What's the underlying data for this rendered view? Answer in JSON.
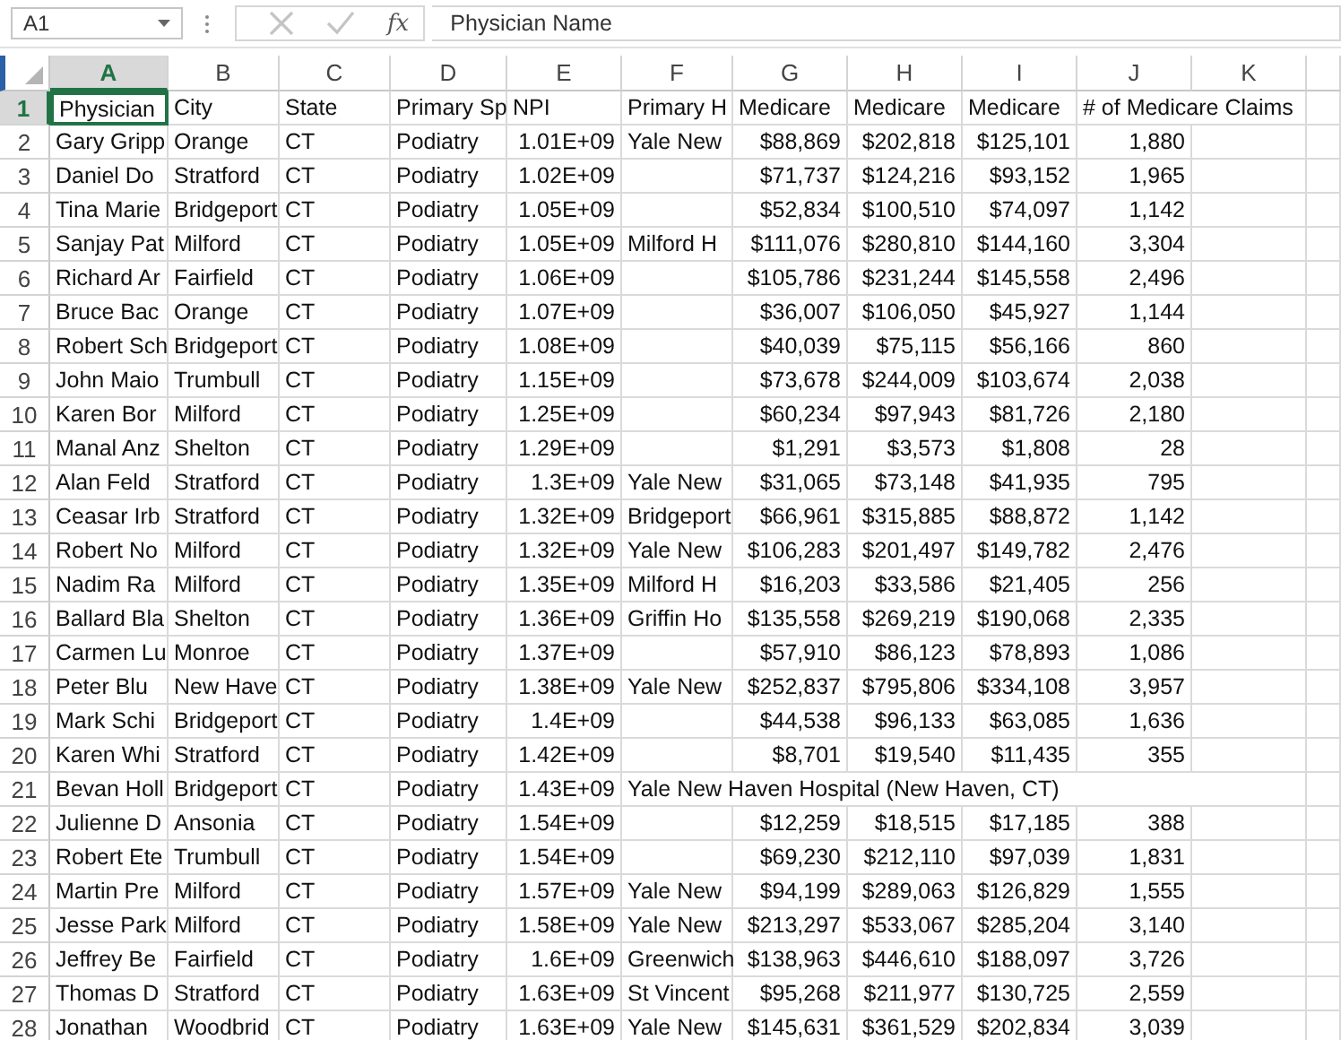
{
  "formula_bar": {
    "name_box": "A1",
    "fx_label": "fx",
    "cancel_disabled": true,
    "enter_disabled": true,
    "value": "Physician Name"
  },
  "column_headers": [
    {
      "label": "A",
      "selected": true
    },
    {
      "label": "B",
      "selected": false
    },
    {
      "label": "C",
      "selected": false
    },
    {
      "label": "D",
      "selected": false
    },
    {
      "label": "E",
      "selected": false
    },
    {
      "label": "F",
      "selected": false
    },
    {
      "label": "G",
      "selected": false
    },
    {
      "label": "H",
      "selected": false
    },
    {
      "label": "I",
      "selected": false
    },
    {
      "label": "J",
      "selected": false
    },
    {
      "label": "K",
      "selected": false
    }
  ],
  "rows": [
    {
      "row": "1",
      "selected": true,
      "physician": "Physician",
      "city": "City",
      "state": "State",
      "specialty": "Primary Sp",
      "npi": "NPI",
      "hospital": "Primary H",
      "medicare_1": "Medicare",
      "medicare_2": "Medicare",
      "medicare_3": "Medicare",
      "claims": "# of Medicare Claims"
    },
    {
      "row": "2",
      "selected": false,
      "physician": "Gary Gripp",
      "city": "Orange",
      "state": "CT",
      "specialty": "Podiatry",
      "npi": "1.01E+09",
      "hospital": "Yale New",
      "medicare_1": "$88,869",
      "medicare_2": "$202,818",
      "medicare_3": "$125,101",
      "claims": "1,880"
    },
    {
      "row": "3",
      "selected": false,
      "physician": "Daniel Do",
      "city": "Stratford",
      "state": "CT",
      "specialty": "Podiatry",
      "npi": "1.02E+09",
      "medicare_1": "$71,737",
      "medicare_2": "$124,216",
      "medicare_3": "$93,152",
      "claims": "1,965"
    },
    {
      "row": "4",
      "selected": false,
      "physician": "Tina Marie",
      "city": "Bridgeport",
      "state": "CT",
      "specialty": "Podiatry",
      "npi": "1.05E+09",
      "medicare_1": "$52,834",
      "medicare_2": "$100,510",
      "medicare_3": "$74,097",
      "claims": "1,142"
    },
    {
      "row": "5",
      "selected": false,
      "physician": "Sanjay Pat",
      "city": "Milford",
      "state": "CT",
      "specialty": "Podiatry",
      "npi": "1.05E+09",
      "hospital": "Milford H",
      "medicare_1": "$111,076",
      "medicare_2": "$280,810",
      "medicare_3": "$144,160",
      "claims": "3,304"
    },
    {
      "row": "6",
      "selected": false,
      "physician": "Richard Ar",
      "city": "Fairfield",
      "state": "CT",
      "specialty": "Podiatry",
      "npi": "1.06E+09",
      "medicare_1": "$105,786",
      "medicare_2": "$231,244",
      "medicare_3": "$145,558",
      "claims": "2,496"
    },
    {
      "row": "7",
      "selected": false,
      "physician": "Bruce Bac",
      "city": "Orange",
      "state": "CT",
      "specialty": "Podiatry",
      "npi": "1.07E+09",
      "medicare_1": "$36,007",
      "medicare_2": "$106,050",
      "medicare_3": "$45,927",
      "claims": "1,144"
    },
    {
      "row": "8",
      "selected": false,
      "physician": "Robert Sch",
      "city": "Bridgeport",
      "state": "CT",
      "specialty": "Podiatry",
      "npi": "1.08E+09",
      "medicare_1": "$40,039",
      "medicare_2": "$75,115",
      "medicare_3": "$56,166",
      "claims": "860"
    },
    {
      "row": "9",
      "selected": false,
      "physician": "John Maio",
      "city": "Trumbull",
      "state": "CT",
      "specialty": "Podiatry",
      "npi": "1.15E+09",
      "medicare_1": "$73,678",
      "medicare_2": "$244,009",
      "medicare_3": "$103,674",
      "claims": "2,038"
    },
    {
      "row": "10",
      "selected": false,
      "physician": "Karen Bor",
      "city": "Milford",
      "state": "CT",
      "specialty": "Podiatry",
      "npi": "1.25E+09",
      "medicare_1": "$60,234",
      "medicare_2": "$97,943",
      "medicare_3": "$81,726",
      "claims": "2,180"
    },
    {
      "row": "11",
      "selected": false,
      "physician": "Manal Anz",
      "city": "Shelton",
      "state": "CT",
      "specialty": "Podiatry",
      "npi": "1.29E+09",
      "medicare_1": "$1,291",
      "medicare_2": "$3,573",
      "medicare_3": "$1,808",
      "claims": "28"
    },
    {
      "row": "12",
      "selected": false,
      "physician": "Alan Feld",
      "city": "Stratford",
      "state": "CT",
      "specialty": "Podiatry",
      "npi": "1.3E+09",
      "hospital": "Yale New",
      "medicare_1": "$31,065",
      "medicare_2": "$73,148",
      "medicare_3": "$41,935",
      "claims": "795"
    },
    {
      "row": "13",
      "selected": false,
      "physician": "Ceasar Irb",
      "city": "Stratford",
      "state": "CT",
      "specialty": "Podiatry",
      "npi": "1.32E+09",
      "hospital": "Bridgeport",
      "medicare_1": "$66,961",
      "medicare_2": "$315,885",
      "medicare_3": "$88,872",
      "claims": "1,142"
    },
    {
      "row": "14",
      "selected": false,
      "physician": "Robert No",
      "city": "Milford",
      "state": "CT",
      "specialty": "Podiatry",
      "npi": "1.32E+09",
      "hospital": "Yale New",
      "medicare_1": "$106,283",
      "medicare_2": "$201,497",
      "medicare_3": "$149,782",
      "claims": "2,476"
    },
    {
      "row": "15",
      "selected": false,
      "physician": "Nadim Ra",
      "city": "Milford",
      "state": "CT",
      "specialty": "Podiatry",
      "npi": "1.35E+09",
      "hospital": "Milford H",
      "medicare_1": "$16,203",
      "medicare_2": "$33,586",
      "medicare_3": "$21,405",
      "claims": "256"
    },
    {
      "row": "16",
      "selected": false,
      "physician": "Ballard Bla",
      "city": "Shelton",
      "state": "CT",
      "specialty": "Podiatry",
      "npi": "1.36E+09",
      "hospital": "Griffin Ho",
      "medicare_1": "$135,558",
      "medicare_2": "$269,219",
      "medicare_3": "$190,068",
      "claims": "2,335"
    },
    {
      "row": "17",
      "selected": false,
      "physician": "Carmen Lu",
      "city": "Monroe",
      "state": "CT",
      "specialty": "Podiatry",
      "npi": "1.37E+09",
      "medicare_1": "$57,910",
      "medicare_2": "$86,123",
      "medicare_3": "$78,893",
      "claims": "1,086"
    },
    {
      "row": "18",
      "selected": false,
      "physician": "Peter Blu",
      "city": "New Have",
      "state": "CT",
      "specialty": "Podiatry",
      "npi": "1.38E+09",
      "hospital": "Yale New",
      "medicare_1": "$252,837",
      "medicare_2": "$795,806",
      "medicare_3": "$334,108",
      "claims": "3,957"
    },
    {
      "row": "19",
      "selected": false,
      "physician": "Mark Schi",
      "city": "Bridgeport",
      "state": "CT",
      "specialty": "Podiatry",
      "npi": "1.4E+09",
      "medicare_1": "$44,538",
      "medicare_2": "$96,133",
      "medicare_3": "$63,085",
      "claims": "1,636"
    },
    {
      "row": "20",
      "selected": false,
      "physician": "Karen Whi",
      "city": "Stratford",
      "state": "CT",
      "specialty": "Podiatry",
      "npi": "1.42E+09",
      "medicare_1": "$8,701",
      "medicare_2": "$19,540",
      "medicare_3": "$11,435",
      "claims": "355"
    },
    {
      "row": "21",
      "selected": false,
      "physician": "Bevan Holl",
      "city": "Bridgeport",
      "state": "CT",
      "specialty": "Podiatry",
      "npi": "1.43E+09",
      "hospital": "Yale New Haven Hospital (New Haven, CT)"
    },
    {
      "row": "22",
      "selected": false,
      "physician": "Julienne D",
      "city": "Ansonia",
      "state": "CT",
      "specialty": "Podiatry",
      "npi": "1.54E+09",
      "medicare_1": "$12,259",
      "medicare_2": "$18,515",
      "medicare_3": "$17,185",
      "claims": "388"
    },
    {
      "row": "23",
      "selected": false,
      "physician": "Robert Ete",
      "city": "Trumbull",
      "state": "CT",
      "specialty": "Podiatry",
      "npi": "1.54E+09",
      "medicare_1": "$69,230",
      "medicare_2": "$212,110",
      "medicare_3": "$97,039",
      "claims": "1,831"
    },
    {
      "row": "24",
      "selected": false,
      "physician": "Martin Pre",
      "city": "Milford",
      "state": "CT",
      "specialty": "Podiatry",
      "npi": "1.57E+09",
      "hospital": "Yale New",
      "medicare_1": "$94,199",
      "medicare_2": "$289,063",
      "medicare_3": "$126,829",
      "claims": "1,555"
    },
    {
      "row": "25",
      "selected": false,
      "physician": "Jesse Park",
      "city": "Milford",
      "state": "CT",
      "specialty": "Podiatry",
      "npi": "1.58E+09",
      "hospital": "Yale New",
      "medicare_1": "$213,297",
      "medicare_2": "$533,067",
      "medicare_3": "$285,204",
      "claims": "3,140"
    },
    {
      "row": "26",
      "selected": false,
      "physician": "Jeffrey Be",
      "city": "Fairfield",
      "state": "CT",
      "specialty": "Podiatry",
      "npi": "1.6E+09",
      "hospital": "Greenwich",
      "medicare_1": "$138,963",
      "medicare_2": "$446,610",
      "medicare_3": "$188,097",
      "claims": "3,726"
    },
    {
      "row": "27",
      "selected": false,
      "physician": "Thomas D",
      "city": "Stratford",
      "state": "CT",
      "specialty": "Podiatry",
      "npi": "1.63E+09",
      "hospital": "St Vincent",
      "medicare_1": "$95,268",
      "medicare_2": "$211,977",
      "medicare_3": "$130,725",
      "claims": "2,559"
    },
    {
      "row": "28",
      "selected": false,
      "physician": "Jonathan",
      "city": "Woodbrid",
      "state": "CT",
      "specialty": "Podiatry",
      "npi": "1.63E+09",
      "hospital": "Yale New",
      "medicare_1": "$145,631",
      "medicare_2": "$361,529",
      "medicare_3": "$202,834",
      "claims": "3,039"
    }
  ]
}
